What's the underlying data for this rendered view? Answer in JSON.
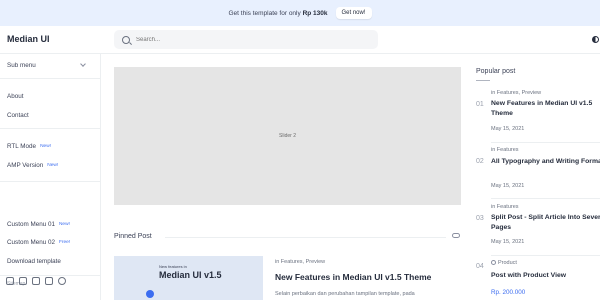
{
  "promo": {
    "text": "Get this template for only",
    "price": "Rp 130k",
    "button": "Get now!"
  },
  "header": {
    "logo": "Median UI",
    "search_placeholder": "Search..."
  },
  "sidebar": {
    "submenu": "Sub menu",
    "items": [
      {
        "label": "About"
      },
      {
        "label": "Contact"
      },
      {
        "label": "RTL Mode",
        "badge": "New!"
      },
      {
        "label": "AMP Version",
        "badge": "New!"
      },
      {
        "label": "Custom Menu 01",
        "badge": "New!"
      },
      {
        "label": "Custom Menu 02",
        "badge": "Free!"
      },
      {
        "label": "Download template"
      },
      {
        "label": "Sitemap"
      }
    ],
    "socials": [
      "instagram-icon",
      "facebook-icon",
      "youtube-icon",
      "linkedin-icon",
      "whatsapp-icon"
    ]
  },
  "main": {
    "slider_label": "Slider 2",
    "pinned_heading": "Pinned Post",
    "pinned": {
      "thumb_label": "New features in",
      "thumb_title": "Median UI v1.5",
      "category": "in Features, Preview",
      "title": "New Features in Median UI v1.5 Theme",
      "snippet": "Selain perbaikan dan perubahan tampilan template, pada"
    }
  },
  "popular": {
    "heading": "Popular post",
    "posts": [
      {
        "num": "01",
        "category": "in Features, Preview",
        "title": "New Features in Median UI v1.5 Theme",
        "date": "May 15, 2021"
      },
      {
        "num": "02",
        "category": "in Features",
        "title": "All Typography and Writing Formats",
        "date": "May 15, 2021"
      },
      {
        "num": "03",
        "category": "in Features",
        "title": "Split Post - Split Article Into Several Pages",
        "date": "May 15, 2021"
      },
      {
        "num": "04",
        "category": "Product",
        "title": "Post with Product View",
        "price": "Rp. 200.000"
      }
    ]
  }
}
